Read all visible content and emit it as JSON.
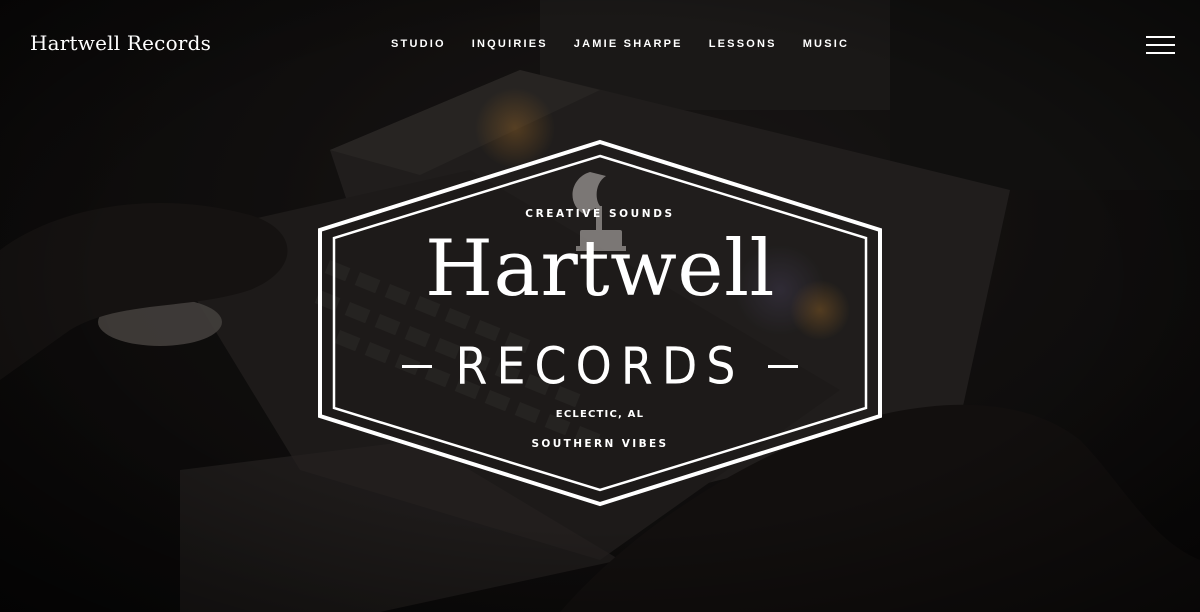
{
  "header": {
    "site_title": "Hartwell Records",
    "nav": [
      {
        "label": "STUDIO"
      },
      {
        "label": "INQUIRIES"
      },
      {
        "label": "JAMIE SHARPE"
      },
      {
        "label": "LESSONS"
      },
      {
        "label": "MUSIC"
      }
    ],
    "menu_icon": "hamburger-menu-icon"
  },
  "hero": {
    "logo": {
      "tagline_top": "CREATIVE SOUNDS",
      "name": "Hartwell",
      "subname": "RECORDS",
      "location": "ECLECTIC, AL",
      "tagline_bottom": "SOUTHERN VIBES",
      "emblem_icon": "gramophone-icon"
    },
    "background_description_icon": "mixing-console-background"
  },
  "colors": {
    "text": "#ffffff",
    "background_dark": "#141212",
    "overlay": "#000000"
  }
}
